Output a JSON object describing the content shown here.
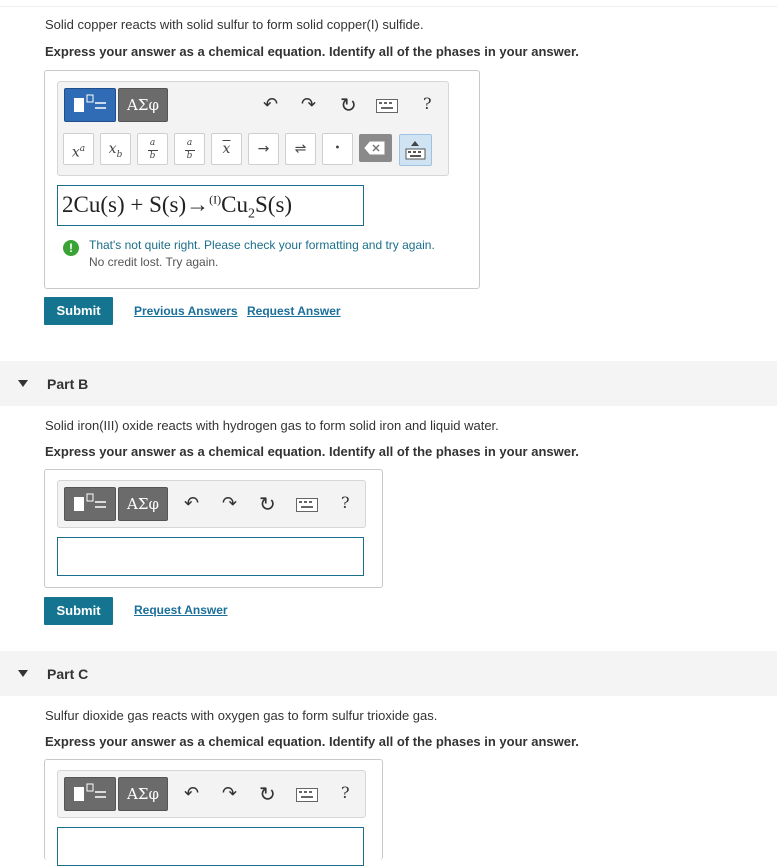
{
  "partA": {
    "prompt": "Solid copper reacts with solid sulfur to form solid copper(I) sulfide.",
    "instruction": "Express your answer as a chemical equation. Identify all of the phases in your answer.",
    "greek_label": "ΑΣφ",
    "help_label": "?",
    "templates": {
      "superscript": "xᵃ",
      "subscript": "x_b",
      "fraction_top": "a",
      "fraction_bottom": "b",
      "mixed_top": "a",
      "mixed_bottom": "b",
      "overline": "x",
      "arrow": "→",
      "equilibrium": "⇌",
      "dot": "•"
    },
    "answer": {
      "coef": "2Cu(s) + S(s)",
      "arrow": "→",
      "sup": "(I)",
      "product_a": "Cu",
      "product_sub": "2",
      "product_b": "S(s)"
    },
    "feedback_line1": "That's not quite right. Please check your formatting and try again.",
    "feedback_line2": "No credit lost. Try again.",
    "submit_label": "Submit",
    "previous_answers_label": "Previous Answers",
    "request_answer_label": "Request Answer"
  },
  "partB": {
    "title": "Part B",
    "prompt": "Solid iron(III) oxide reacts with hydrogen gas to form solid iron and liquid water.",
    "instruction": "Express your answer as a chemical equation. Identify all of the phases in your answer.",
    "greek_label": "ΑΣφ",
    "help_label": "?",
    "submit_label": "Submit",
    "request_answer_label": "Request Answer"
  },
  "partC": {
    "title": "Part C",
    "prompt": "Sulfur dioxide gas reacts with oxygen gas to form sulfur trioxide gas.",
    "instruction": "Express your answer as a chemical equation. Identify all of the phases in your answer.",
    "greek_label": "ΑΣφ",
    "help_label": "?"
  },
  "colors": {
    "accent": "#2f6cb5",
    "submit": "#157590",
    "feedback": "#1b6f8a",
    "link": "#1b6f9b"
  }
}
